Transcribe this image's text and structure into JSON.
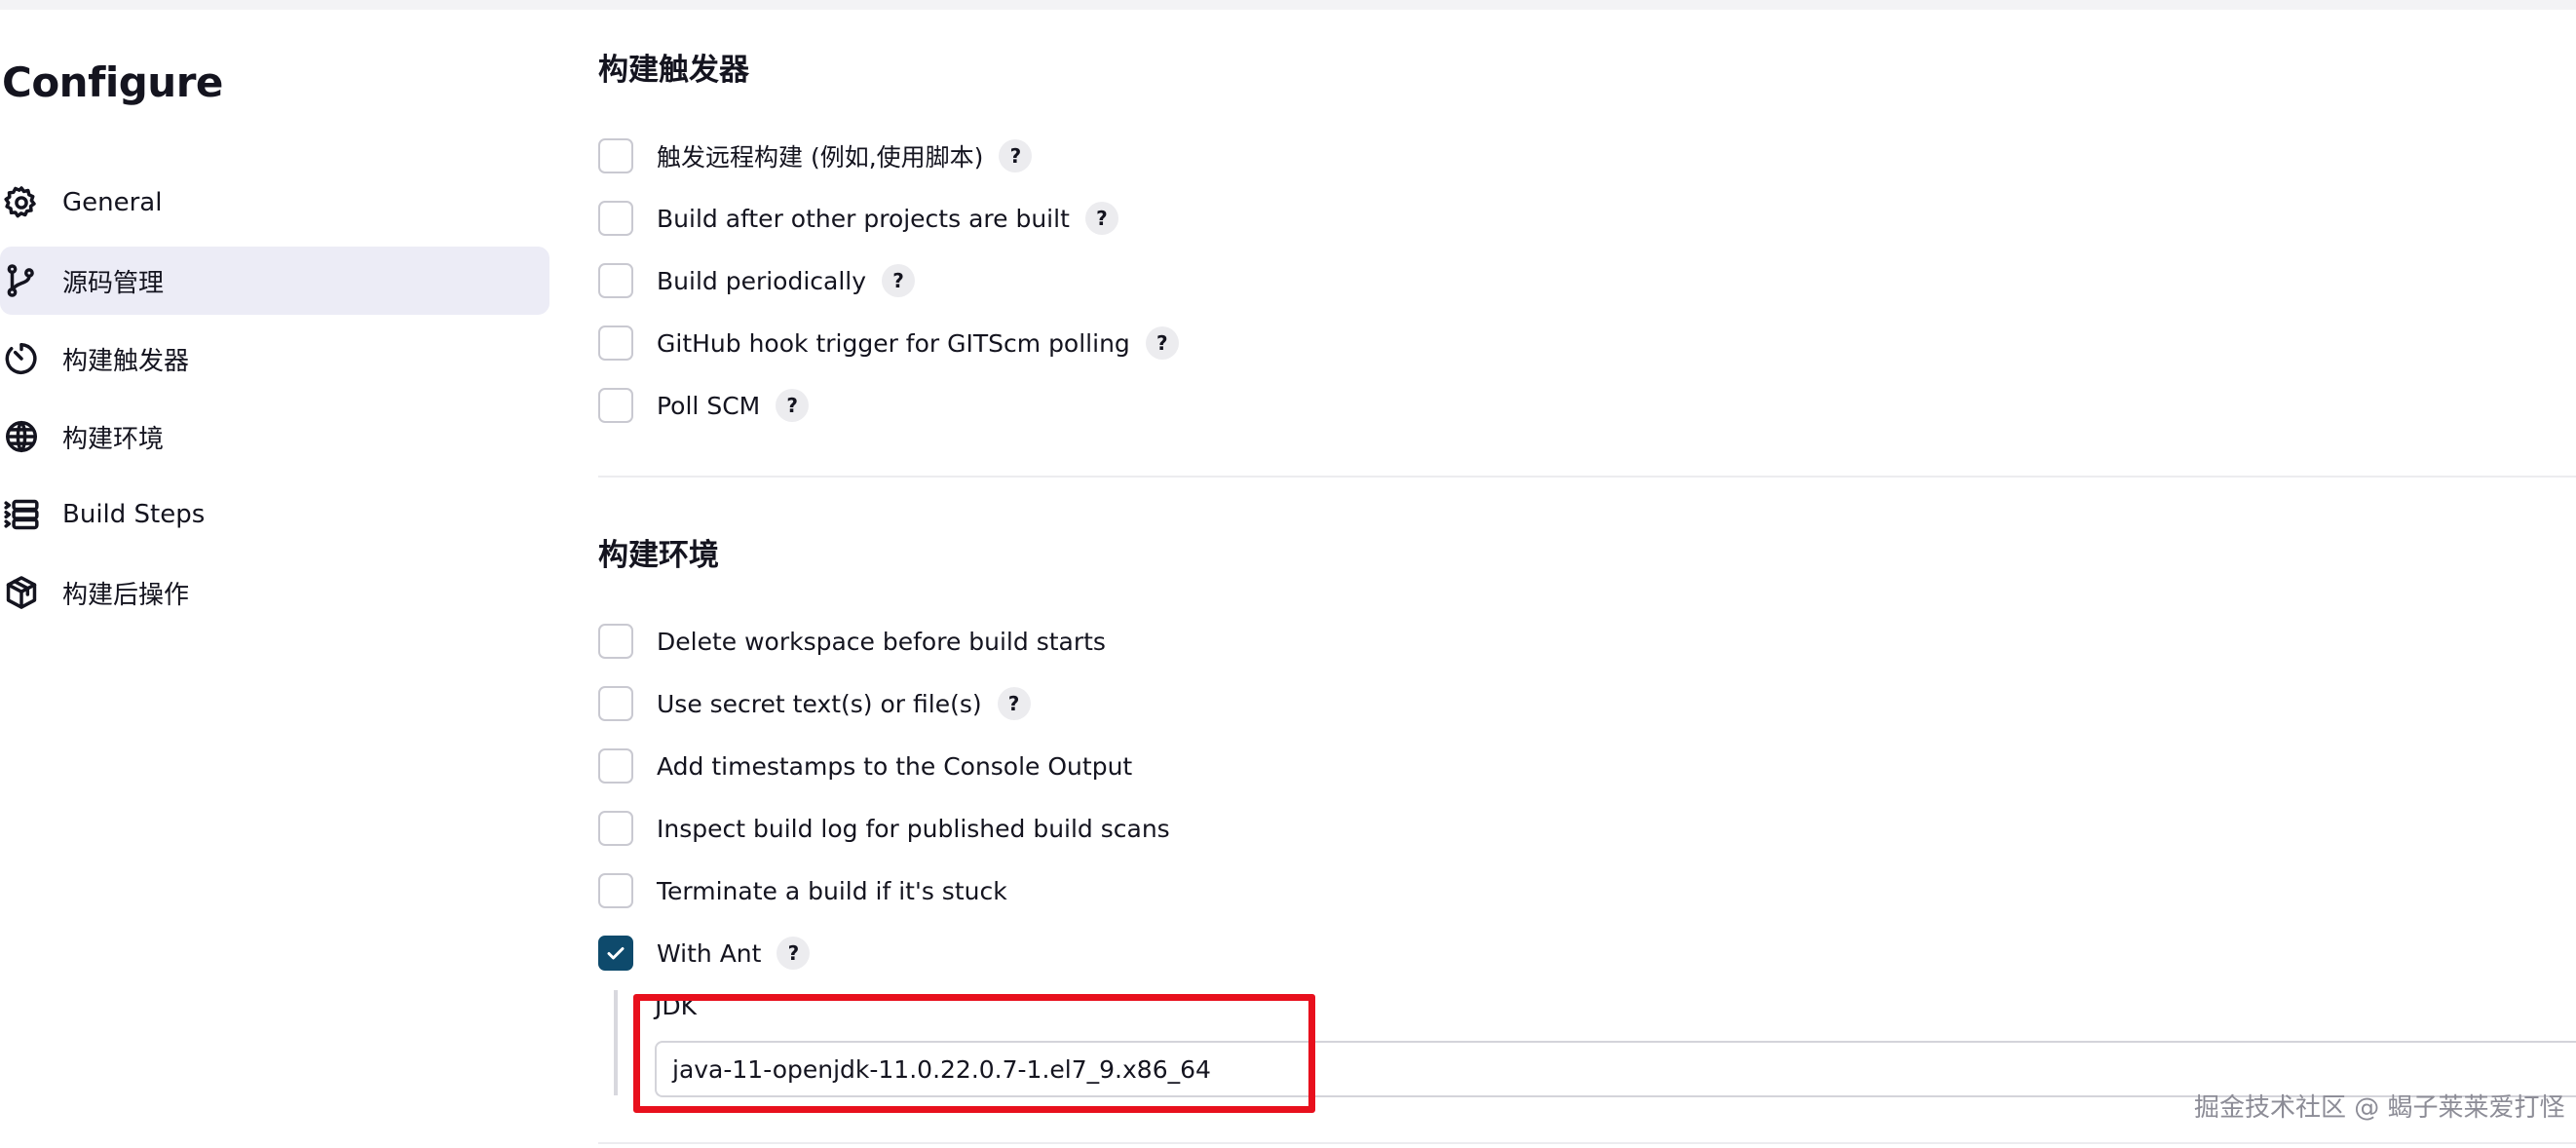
{
  "sidebar": {
    "title": "Configure",
    "items": [
      {
        "label": "General",
        "icon": "gear-icon",
        "active": false
      },
      {
        "label": "源码管理",
        "icon": "branch-icon",
        "active": true
      },
      {
        "label": "构建触发器",
        "icon": "clock-icon",
        "active": false
      },
      {
        "label": "构建环境",
        "icon": "globe-icon",
        "active": false
      },
      {
        "label": "Build Steps",
        "icon": "list-icon",
        "active": false
      },
      {
        "label": "构建后操作",
        "icon": "package-icon",
        "active": false
      }
    ]
  },
  "triggers": {
    "title": "构建触发器",
    "items": [
      {
        "label": "触发远程构建 (例如,使用脚本)",
        "checked": false,
        "help": "?"
      },
      {
        "label": "Build after other projects are built",
        "checked": false,
        "help": "?"
      },
      {
        "label": "Build periodically",
        "checked": false,
        "help": "?"
      },
      {
        "label": "GitHub hook trigger for GITScm polling",
        "checked": false,
        "help": "?"
      },
      {
        "label": "Poll SCM",
        "checked": false,
        "help": "?"
      }
    ]
  },
  "environment": {
    "title": "构建环境",
    "items": [
      {
        "label": "Delete workspace before build starts",
        "checked": false
      },
      {
        "label": "Use secret text(s) or file(s)",
        "checked": false,
        "help": "?"
      },
      {
        "label": "Add timestamps to the Console Output",
        "checked": false
      },
      {
        "label": "Inspect build log for published build scans",
        "checked": false
      },
      {
        "label": "Terminate a build if it's stuck",
        "checked": false
      },
      {
        "label": "With Ant",
        "checked": true,
        "help": "?"
      }
    ],
    "jdk": {
      "label": "JDK",
      "value": "java-11-openjdk-11.0.22.0.7-1.el7_9.x86_64"
    }
  },
  "watermark": "掘金技术社区 @ 蝎子莱莱爱打怪",
  "colors": {
    "active_bg": "#ececf6",
    "checkbox_checked": "#0e4a6c",
    "highlight": "#e8101d"
  }
}
